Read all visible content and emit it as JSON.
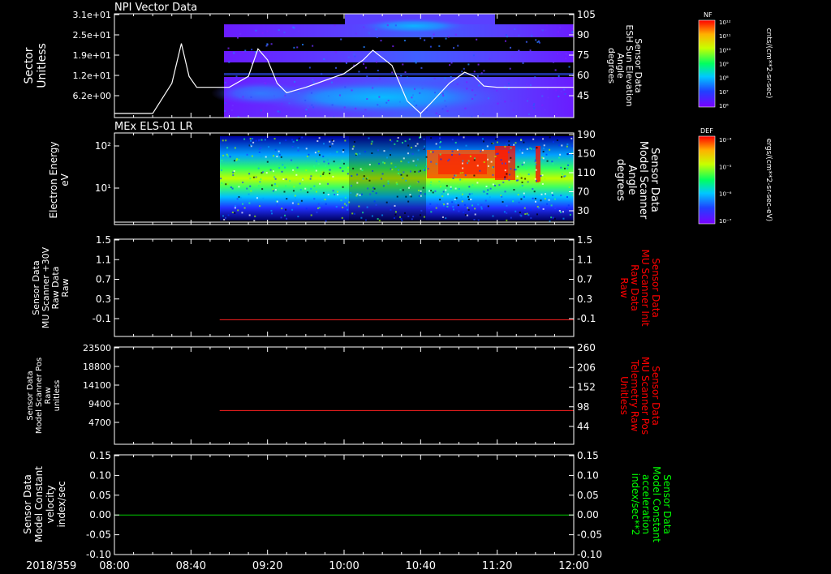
{
  "time_axis": {
    "date_label": "2018/359",
    "ticks": [
      "08:00",
      "08:40",
      "09:20",
      "10:00",
      "10:40",
      "11:20",
      "12:00"
    ]
  },
  "colors": {
    "background": "#000000",
    "axis": "#ffffff",
    "red_label": "#ff0000",
    "green_label": "#00ff00",
    "trace_red": "#ff2020",
    "trace_green": "#00cc00"
  },
  "chart_data": [
    {
      "type": "heatmap",
      "title": "NPI Vector Data",
      "ylabel_left": [
        "Sector",
        "Unitless"
      ],
      "ytick_left": [
        "3.1e+01",
        "2.5e+01",
        "1.9e+01",
        "1.2e+01",
        "6.2e+00"
      ],
      "ylabel_right": [
        "Sensor Data",
        "ESH Sun Elevation",
        "Angle",
        "degrees"
      ],
      "ytick_right": [
        "105",
        "90",
        "75",
        "60",
        "45"
      ],
      "ylim_right": [
        30,
        105
      ],
      "colorbar": {
        "label": "NF",
        "unit": "cnts/(cm**2-sr-sec)",
        "ticks": [
          "10¹²",
          "10¹¹",
          "10¹⁰",
          "10⁹",
          "10⁸",
          "10⁷",
          "10⁶"
        ]
      },
      "overlay_line": {
        "name": "ESH Sun Elevation Angle",
        "x": [
          "08:00",
          "08:20",
          "08:30",
          "08:35",
          "08:39",
          "08:43",
          "08:48",
          "09:00",
          "09:10",
          "09:15",
          "09:20",
          "09:25",
          "09:30",
          "09:35",
          "09:40",
          "10:00",
          "10:10",
          "10:15",
          "10:25",
          "10:33",
          "10:40",
          "10:45",
          "10:55",
          "11:03",
          "11:08",
          "11:13",
          "11:20",
          "12:00"
        ],
        "y": [
          33,
          33,
          55,
          84,
          60,
          52,
          52,
          52,
          60,
          80,
          72,
          55,
          48,
          50,
          52,
          62,
          72,
          79,
          68,
          42,
          33,
          40,
          55,
          63,
          60,
          53,
          52,
          52
        ]
      }
    },
    {
      "type": "heatmap",
      "title": "MEx ELS-01 LR",
      "ylabel_left": [
        "Electron Energy",
        "eV"
      ],
      "ytick_left": [
        "10²",
        "10¹"
      ],
      "ylabel_right": [
        "Sensor Data",
        "Model Scanner",
        "Angle",
        "degrees"
      ],
      "ytick_right": [
        "190",
        "150",
        "110",
        "70",
        "30"
      ],
      "colorbar": {
        "label": "DEF",
        "unit": "ergs/(cm**2-sr-sec-eV)",
        "ticks": [
          "10⁻⁴",
          "10⁻⁵",
          "10⁻⁶",
          "10⁻⁷"
        ]
      }
    },
    {
      "type": "line",
      "ylabel_left": [
        "Sensor Data",
        "MU Scanner +30V",
        "Raw Data",
        "Raw"
      ],
      "ytick_left": [
        "1.5",
        "1.1",
        "0.7",
        "0.3",
        "-0.1"
      ],
      "ylim_left": [
        -0.3,
        1.5
      ],
      "ylabel_right": [
        "Sensor Data",
        "MU Scanner Init",
        "Raw Data",
        "Raw"
      ],
      "ytick_right": [
        "1.5",
        "1.1",
        "0.7",
        "0.3",
        "-0.1"
      ],
      "series": [
        {
          "x": [
            "08:55",
            "12:00"
          ],
          "y": [
            0,
            0
          ]
        }
      ]
    },
    {
      "type": "line",
      "ylabel_left": [
        "Sensor Data",
        "Model Scanner Pos",
        "Raw",
        "unitless"
      ],
      "ytick_left": [
        "23500",
        "18800",
        "14100",
        "9400",
        "4700"
      ],
      "ylim_left": [
        0,
        23500
      ],
      "ylabel_right": [
        "Sensor Data",
        "MU Scanner Pos",
        "Telemetry Raw",
        "Unitless"
      ],
      "ytick_right": [
        "260",
        "206",
        "152",
        "98",
        "44"
      ],
      "series": [
        {
          "x": [
            "08:55",
            "12:00"
          ],
          "y": [
            8100,
            8100
          ]
        }
      ]
    },
    {
      "type": "line",
      "ylabel_left": [
        "Sensor Data",
        "Model Constant",
        "velocity",
        "index/sec"
      ],
      "ytick_left": [
        "0.15",
        "0.10",
        "0.05",
        "0.00",
        "-0.05",
        "-0.10"
      ],
      "ylim_left": [
        -0.1,
        0.15
      ],
      "ylabel_right": [
        "Sensor Data",
        "Model Constant",
        "acceleration",
        "index/sec**2"
      ],
      "ytick_right": [
        "0.15",
        "0.10",
        "0.05",
        "0.00",
        "-0.05",
        "-0.10"
      ],
      "series": [
        {
          "x": [
            "08:00",
            "12:00"
          ],
          "y": [
            0,
            0
          ]
        }
      ]
    }
  ]
}
